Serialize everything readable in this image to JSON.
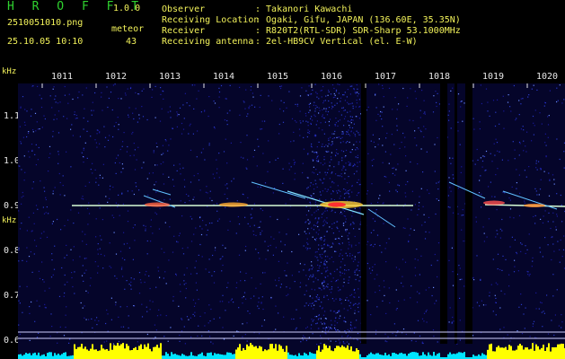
{
  "header": {
    "app_title": "H R O F F T",
    "version": "1.0.0",
    "filename": "2510051010.png",
    "datetime": "25.10.05 10:10",
    "meteor_label": "meteor",
    "meteor_count": "43"
  },
  "info": [
    {
      "key": "Observer",
      "value": ": Takanori Kawachi"
    },
    {
      "key": "Receiving Location",
      "value": ": Ogaki, Gifu, JAPAN (136.60E, 35.35N)"
    },
    {
      "key": "Receiver",
      "value": ": R820T2(RTL-SDR) SDR-Sharp 53.1000MHz"
    },
    {
      "key": "Receiving antenna",
      "value": ": 2el-HB9CV Vertical (el. E-W)"
    }
  ],
  "axis": {
    "y_unit_top": "kHz",
    "y_unit_mid": "kHz",
    "y_ticks": [
      "1.1",
      "1.0",
      "0.9",
      "0.8",
      "0.7",
      "0.6"
    ],
    "x_ticks": [
      "1011",
      "1012",
      "1013",
      "1014",
      "1015",
      "1016",
      "1017",
      "1018",
      "1019",
      "1020"
    ]
  },
  "colors": {
    "background": "#000000",
    "noise": "#1a1a9a",
    "signal": "#ffffff",
    "meteor_hot": "#ff3030",
    "level_bar_yellow": "#ffff00",
    "level_bar_cyan": "#00e5ff"
  }
}
